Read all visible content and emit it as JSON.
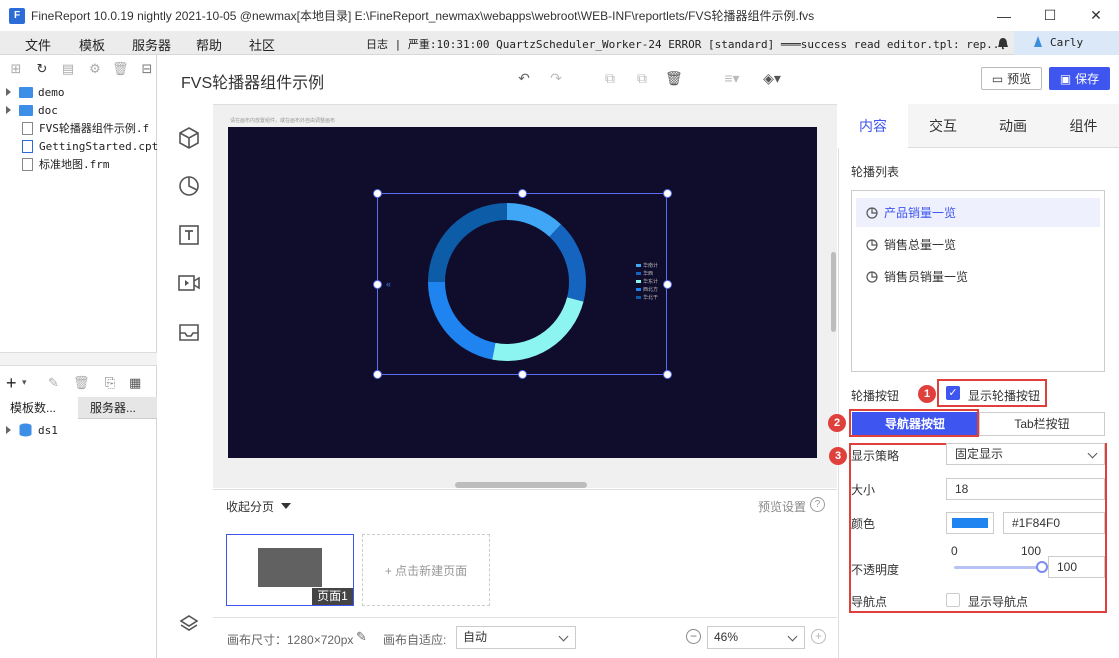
{
  "window": {
    "title": "FineReport 10.0.19 nightly 2021-10-05 @newmax[本地目录]     E:\\FineReport_newmax\\webapps\\webroot\\WEB-INF\\reportlets/FVS轮播器组件示例.fvs",
    "minimize": "—",
    "maximize": "☐",
    "close": "✕"
  },
  "menu": {
    "items": [
      "文件",
      "模板",
      "服务器",
      "帮助",
      "社区"
    ],
    "log": "日志 | 严重:10:31:00 QuartzScheduler_Worker-24 ERROR [standard] ═══success read editor.tpl: rep...",
    "user": "Carly"
  },
  "left_panel": {
    "tree": [
      {
        "label": "demo",
        "kind": "folder"
      },
      {
        "label": "doc",
        "kind": "folder"
      },
      {
        "label": "FVS轮播器组件示例.f",
        "kind": "file"
      },
      {
        "label": "GettingStarted.cpt",
        "kind": "file"
      },
      {
        "label": "标准地图.frm",
        "kind": "file"
      }
    ],
    "tabs": [
      "模板数...",
      "服务器..."
    ],
    "datasource": "ds1"
  },
  "workspace": {
    "title": "FVS轮播器组件示例",
    "preview": "预览",
    "save": "保存"
  },
  "canvas": {
    "hint": "请在画布内放置组件，或在画布外自由调整画布",
    "legend": [
      "华南计",
      "华西",
      "华东计",
      "西北方",
      "华北干"
    ],
    "nav_arrow": "«"
  },
  "chart_data": {
    "type": "pie",
    "colors": [
      "#3fa7f5",
      "#1565c0",
      "#8cf5f2",
      "#1f84f0",
      "#0d5ca8"
    ],
    "values": [
      12,
      17,
      24,
      22,
      25
    ]
  },
  "pages": {
    "collapse": "收起分页",
    "preview_setting": "预览设置",
    "page1": "页面1",
    "new_page": "+ 点击新建页面"
  },
  "bottom": {
    "canvas_size": "画布尺寸：1280×720px",
    "adapt_label": "画布自适应:",
    "adapt_value": "自动",
    "zoom": "46%"
  },
  "right_panel": {
    "tabs": [
      "内容",
      "交互",
      "动画",
      "组件"
    ],
    "carousel_list_label": "轮播列表",
    "carousel_items": [
      "产品销量一览",
      "销售总量一览",
      "销售员销量一览"
    ],
    "carousel_button_label": "轮播按钮",
    "show_button": "显示轮播按钮",
    "nav_button": "导航器按钮",
    "tab_button": "Tab栏按钮",
    "strategy_label": "显示策略",
    "strategy_value": "固定显示",
    "size_label": "大小",
    "size_value": "18",
    "color_label": "颜色",
    "color_value": "#1F84F0",
    "opacity_label": "不透明度",
    "opacity_min": "0",
    "opacity_max": "100",
    "opacity_value": "100",
    "nav_dot_label": "导航点",
    "show_nav_dot": "显示导航点",
    "badges": [
      "1",
      "2",
      "3"
    ]
  }
}
